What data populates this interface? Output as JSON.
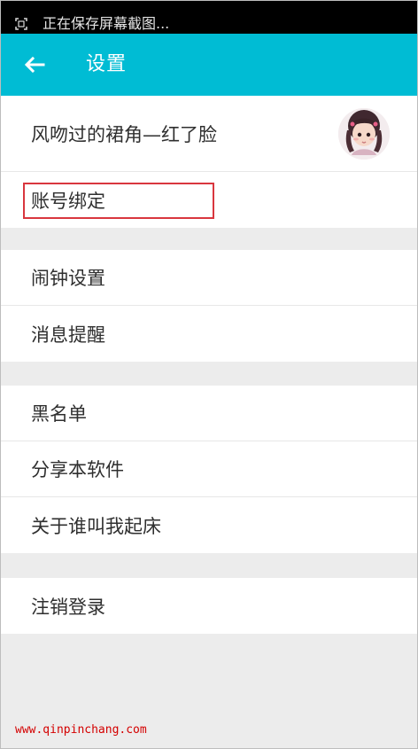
{
  "status_bar": {
    "notification_text": "正在保存屏幕截图...",
    "icon": "screenshot-icon"
  },
  "app_bar": {
    "back_icon": "arrow-left-icon",
    "title": "设置",
    "background_color": "#00bcd4"
  },
  "sections": [
    {
      "items": [
        {
          "label": "风吻过的裙角—红了脸",
          "avatar_icon": "avatar-icon"
        },
        {
          "label": "账号绑定",
          "highlight_color": "#d9363e"
        }
      ]
    },
    {
      "items": [
        {
          "label": "闹钟设置"
        },
        {
          "label": "消息提醒"
        }
      ]
    },
    {
      "items": [
        {
          "label": "黑名单"
        },
        {
          "label": "分享本软件"
        },
        {
          "label": "关于谁叫我起床"
        }
      ]
    },
    {
      "items": [
        {
          "label": "注销登录"
        }
      ]
    }
  ],
  "watermark": {
    "text": "www.qinpinchang.com",
    "color": "#d40000"
  }
}
